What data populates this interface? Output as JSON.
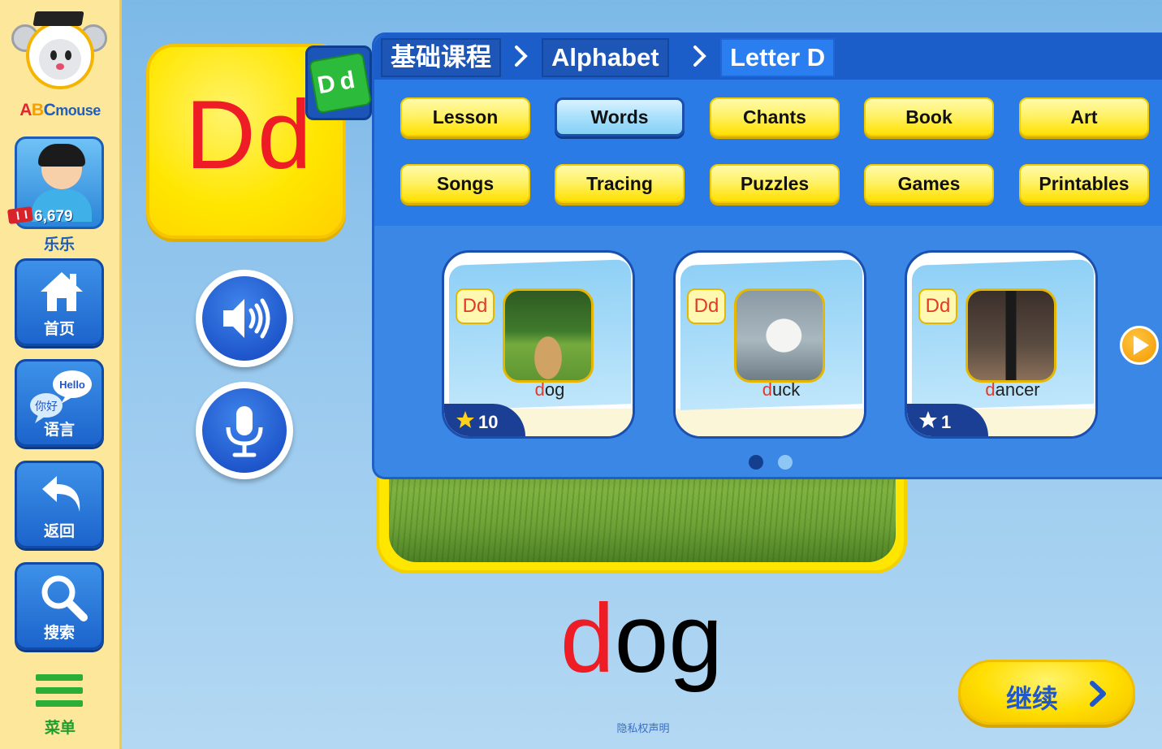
{
  "sidebar": {
    "logo": {
      "prefix_a": "A",
      "prefix_b": "B",
      "prefix_c": "C",
      "suffix": "mouse"
    },
    "profile": {
      "points": "6,679",
      "name": "乐乐"
    },
    "buttons": [
      {
        "id": "home",
        "label": "首页",
        "icon": "home-icon"
      },
      {
        "id": "language",
        "label": "语言",
        "icon": "speech-bubbles-icon",
        "bubble_en": "Hello",
        "bubble_cn": "你好"
      },
      {
        "id": "back",
        "label": "返回",
        "icon": "back-arrow-icon"
      },
      {
        "id": "search",
        "label": "搜索",
        "icon": "search-icon"
      }
    ],
    "menu": {
      "label": "菜单",
      "icon": "hamburger-icon"
    }
  },
  "letter_card": {
    "letters": "Dd",
    "cube_text": "Dd"
  },
  "main": {
    "word": {
      "first": "d",
      "rest": "og"
    },
    "continue_label": "继续",
    "privacy": "隐私权声明"
  },
  "panel": {
    "breadcrumb": [
      "基础课程",
      "Alphabet",
      "Letter D"
    ],
    "tabs": [
      "Lesson",
      "Words",
      "Chants",
      "Book",
      "Art",
      "Songs",
      "Tracing",
      "Puzzles",
      "Games",
      "Printables"
    ],
    "selected_tab": "Words",
    "cards": [
      {
        "letters": "Dd",
        "word_first": "d",
        "word_rest": "og",
        "stars": "10",
        "has_stars": true
      },
      {
        "letters": "Dd",
        "word_first": "d",
        "word_rest": "uck",
        "stars": "",
        "has_stars": false
      },
      {
        "letters": "Dd",
        "word_first": "d",
        "word_rest": "ancer",
        "stars": "1",
        "has_stars": true
      }
    ],
    "pagination": {
      "current": 1,
      "total": 2
    }
  },
  "colors": {
    "accent_red": "#ee1c24",
    "brand_blue": "#1f57cc",
    "button_yellow": "#ffe600",
    "sidebar_bg": "#fde79a",
    "menu_green": "#2aae38"
  }
}
